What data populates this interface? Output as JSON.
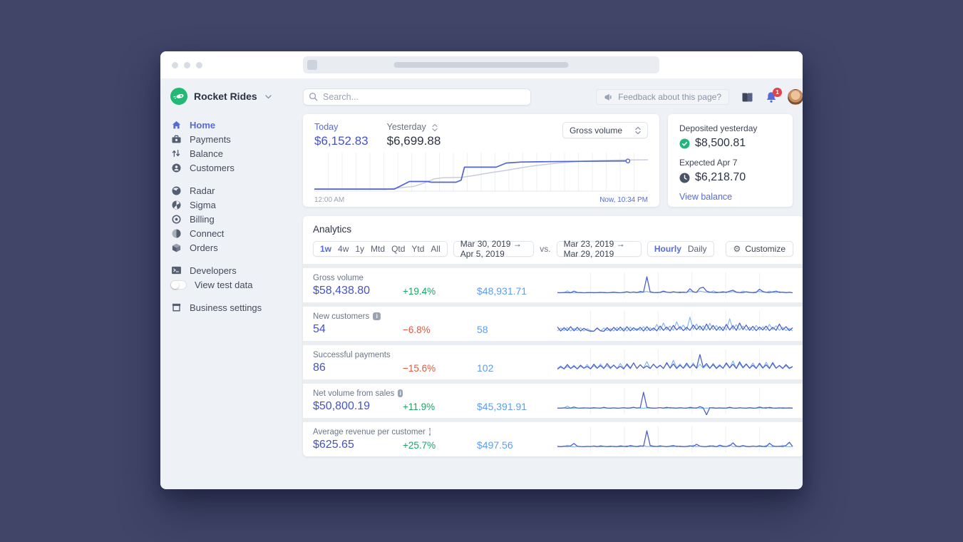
{
  "colors": {
    "accent": "#556cd6",
    "value_indigo": "#4453c8",
    "positive": "#1ea366",
    "negative": "#e4593f",
    "previous_blue": "#5e9df0",
    "spark_current": "#4f61c9",
    "spark_previous": "#7bb3f0",
    "today_line": "#5065cf",
    "yesterday_line": "#c8ced9",
    "check_green": "#24b47e",
    "badge_red": "#e2434b",
    "logo_green": "#23b873"
  },
  "brand": {
    "name": "Rocket Rides"
  },
  "sidebar": {
    "groups": [
      {
        "items": [
          {
            "label": "Home",
            "icon": "home-icon",
            "active": true
          },
          {
            "label": "Payments",
            "icon": "payments-icon"
          },
          {
            "label": "Balance",
            "icon": "balance-icon"
          },
          {
            "label": "Customers",
            "icon": "customers-icon"
          }
        ]
      },
      {
        "items": [
          {
            "label": "Radar",
            "icon": "radar-icon"
          },
          {
            "label": "Sigma",
            "icon": "sigma-icon"
          },
          {
            "label": "Billing",
            "icon": "billing-icon"
          },
          {
            "label": "Connect",
            "icon": "connect-icon"
          },
          {
            "label": "Orders",
            "icon": "orders-icon"
          }
        ]
      },
      {
        "items": [
          {
            "label": "Developers",
            "icon": "developers-icon"
          },
          {
            "label": "View test data",
            "icon": "toggle-switch",
            "toggle": true
          }
        ]
      },
      {
        "items": [
          {
            "label": "Business settings",
            "icon": "settings-icon"
          }
        ]
      }
    ]
  },
  "topbar": {
    "search_placeholder": "Search...",
    "feedback_label": "Feedback about this page?",
    "notification_count": "1"
  },
  "overview": {
    "today_label": "Today",
    "today_value": "$6,152.83",
    "yesterday_label": "Yesterday",
    "yesterday_value": "$6,699.88",
    "metric_select": "Gross volume",
    "x_start": "12:00 AM",
    "x_end": "Now, 10:34 PM"
  },
  "balance_card": {
    "deposited_label": "Deposited yesterday",
    "deposited_value": "$8,500.81",
    "expected_label": "Expected Apr 7",
    "expected_value": "$6,218.70",
    "link": "View balance"
  },
  "analytics": {
    "title": "Analytics",
    "periods": [
      "1w",
      "4w",
      "1y",
      "Mtd",
      "Qtd",
      "Ytd",
      "All"
    ],
    "active_period": "1w",
    "range_primary": "Mar 30, 2019 →  Apr 5, 2019",
    "vs_label": "vs.",
    "range_compare": "Mar 23, 2019 → Mar 29, 2019",
    "granularities": [
      "Hourly",
      "Daily"
    ],
    "active_granularity": "Hourly",
    "customize_label": "Customize"
  },
  "chart_data": {
    "type": "line",
    "title": "Gross volume — Today vs Yesterday (cumulative)",
    "x_range": [
      "12:00 AM",
      "Now, 10:34 PM"
    ],
    "grid": true,
    "series": [
      {
        "name": "Today",
        "end_label": "$6,152.83",
        "points": [
          [
            0,
            0.04
          ],
          [
            0.24,
            0.04
          ],
          [
            0.285,
            0.26
          ],
          [
            0.34,
            0.26
          ],
          [
            0.35,
            0.24
          ],
          [
            0.425,
            0.24
          ],
          [
            0.44,
            0.3
          ],
          [
            0.45,
            0.68
          ],
          [
            0.545,
            0.68
          ],
          [
            0.575,
            0.8
          ],
          [
            0.62,
            0.83
          ],
          [
            0.7,
            0.84
          ],
          [
            0.8,
            0.85
          ],
          [
            0.94,
            0.86
          ]
        ],
        "marker_at": [
          0.94,
          0.86
        ]
      },
      {
        "name": "Yesterday",
        "end_label": "$6,699.88",
        "points": [
          [
            0,
            0.03
          ],
          [
            0.215,
            0.03
          ],
          [
            0.25,
            0.07
          ],
          [
            0.3,
            0.12
          ],
          [
            0.33,
            0.22
          ],
          [
            0.36,
            0.34
          ],
          [
            0.385,
            0.37
          ],
          [
            0.44,
            0.38
          ],
          [
            0.47,
            0.42
          ],
          [
            0.53,
            0.52
          ],
          [
            0.57,
            0.58
          ],
          [
            0.62,
            0.66
          ],
          [
            0.66,
            0.72
          ],
          [
            0.72,
            0.79
          ],
          [
            0.78,
            0.84
          ],
          [
            0.84,
            0.87
          ],
          [
            0.9,
            0.885
          ],
          [
            1,
            0.895
          ]
        ]
      }
    ]
  },
  "metrics": [
    {
      "label": "Gross volume",
      "value": "$58,438.80",
      "delta": "+19.4%",
      "trend": "up",
      "previous": "$48,931.71",
      "info": false,
      "spark": {
        "current": [
          3,
          2,
          4,
          3,
          2,
          12,
          4,
          3,
          2,
          3,
          4,
          2,
          3,
          5,
          3,
          2,
          4,
          6,
          3,
          2,
          5,
          8,
          4,
          6,
          3,
          10,
          6,
          100,
          8,
          4,
          3,
          5,
          12,
          6,
          4,
          8,
          5,
          3,
          6,
          4,
          26,
          8,
          5,
          30,
          36,
          12,
          6,
          4,
          3,
          5,
          8,
          4,
          12,
          18,
          6,
          4,
          3,
          8,
          5,
          3,
          4,
          24,
          10,
          5,
          3,
          8,
          12,
          4,
          6,
          3,
          5,
          2
        ],
        "previous": [
          2,
          3,
          2,
          14,
          3,
          2,
          3,
          4,
          2,
          3,
          2,
          4,
          3,
          2,
          5,
          3,
          2,
          3,
          4,
          2,
          3,
          6,
          3,
          8,
          4,
          3,
          6,
          10,
          5,
          3,
          4,
          3,
          8,
          5,
          3,
          6,
          4,
          8,
          3,
          5,
          10,
          6,
          4,
          12,
          8,
          5,
          3,
          14,
          6,
          4,
          3,
          8,
          5,
          10,
          4,
          3,
          12,
          6,
          3,
          4,
          8,
          10,
          6,
          4,
          12,
          5,
          3,
          9,
          4,
          3,
          6,
          2
        ]
      }
    },
    {
      "label": "New customers",
      "value": "54",
      "delta": "−6.8%",
      "trend": "down",
      "previous": "58",
      "info": true,
      "spark": {
        "current": [
          28,
          4,
          24,
          6,
          30,
          5,
          26,
          4,
          20,
          8,
          2,
          3,
          22,
          5,
          2,
          24,
          4,
          26,
          6,
          28,
          4,
          30,
          5,
          24,
          8,
          26,
          4,
          30,
          6,
          22,
          5,
          34,
          8,
          28,
          5,
          38,
          10,
          30,
          6,
          26,
          8,
          40,
          12,
          34,
          8,
          46,
          10,
          38,
          8,
          30,
          6,
          44,
          10,
          36,
          8,
          52,
          12,
          40,
          8,
          32,
          6,
          28,
          10,
          34,
          6,
          26,
          8,
          46,
          10,
          30,
          6,
          24
        ],
        "previous": [
          4,
          22,
          6,
          26,
          4,
          20,
          6,
          24,
          4,
          18,
          6,
          2,
          20,
          4,
          22,
          6,
          18,
          4,
          26,
          6,
          22,
          4,
          28,
          6,
          20,
          8,
          30,
          5,
          24,
          6,
          44,
          8,
          52,
          10,
          34,
          8,
          60,
          12,
          40,
          8,
          88,
          14,
          46,
          10,
          36,
          8,
          50,
          12,
          38,
          8,
          30,
          10,
          78,
          14,
          42,
          10,
          34,
          8,
          28,
          6,
          38,
          10,
          30,
          8,
          44,
          12,
          36,
          8,
          26,
          6,
          20,
          4
        ]
      }
    },
    {
      "label": "Successful payments",
      "value": "86",
      "delta": "−15.6%",
      "trend": "down",
      "previous": "102",
      "info": false,
      "spark": {
        "current": [
          6,
          20,
          8,
          34,
          10,
          24,
          8,
          30,
          12,
          22,
          8,
          36,
          12,
          28,
          10,
          40,
          14,
          30,
          10,
          24,
          8,
          38,
          12,
          44,
          10,
          32,
          12,
          26,
          10,
          36,
          14,
          30,
          10,
          46,
          12,
          38,
          10,
          30,
          12,
          42,
          14,
          34,
          12,
          95,
          18,
          40,
          12,
          34,
          10,
          28,
          12,
          44,
          14,
          36,
          10,
          50,
          16,
          38,
          12,
          30,
          10,
          42,
          14,
          32,
          10,
          46,
          12,
          28,
          10,
          34,
          12,
          22
        ],
        "previous": [
          10,
          26,
          8,
          22,
          10,
          30,
          8,
          24,
          10,
          34,
          8,
          26,
          10,
          38,
          12,
          28,
          8,
          32,
          10,
          40,
          12,
          30,
          8,
          44,
          10,
          34,
          12,
          52,
          10,
          36,
          12,
          28,
          10,
          40,
          12,
          60,
          14,
          38,
          10,
          32,
          12,
          44,
          10,
          36,
          12,
          30,
          10,
          42,
          14,
          34,
          10,
          38,
          12,
          56,
          10,
          40,
          12,
          34,
          10,
          44,
          12,
          36,
          10,
          48,
          14,
          38,
          10,
          30,
          12,
          26,
          8,
          20
        ]
      }
    },
    {
      "label": "Net volume from sales",
      "value": "$50,800.19",
      "delta": "+11.9%",
      "trend": "up",
      "previous": "$45,391.91",
      "info": true,
      "spark": {
        "current": [
          4,
          3,
          5,
          3,
          4,
          10,
          4,
          3,
          5,
          4,
          3,
          6,
          4,
          3,
          8,
          4,
          3,
          5,
          3,
          4,
          6,
          3,
          5,
          8,
          4,
          6,
          100,
          8,
          5,
          3,
          4,
          6,
          3,
          8,
          4,
          5,
          3,
          6,
          4,
          3,
          8,
          5,
          3,
          12,
          5,
          -38,
          6,
          4,
          3,
          5,
          3,
          4,
          8,
          4,
          3,
          5,
          4,
          3,
          6,
          3,
          4,
          10,
          5,
          3,
          8,
          4,
          3,
          5,
          3,
          4,
          5,
          3
        ],
        "previous": [
          3,
          2,
          4,
          16,
          3,
          2,
          4,
          3,
          2,
          5,
          3,
          2,
          4,
          3,
          5,
          2,
          3,
          4,
          2,
          3,
          5,
          3,
          2,
          6,
          3,
          4,
          2,
          5,
          3,
          2,
          4,
          6,
          3,
          2,
          8,
          3,
          2,
          4,
          3,
          5,
          2,
          3,
          6,
          3,
          2,
          4,
          3,
          8,
          2,
          3,
          4,
          2,
          5,
          3,
          2,
          6,
          3,
          2,
          4,
          3,
          2,
          5,
          3,
          8,
          2,
          3,
          4,
          2,
          6,
          3,
          2,
          4
        ]
      }
    },
    {
      "label": "Average revenue per customer",
      "value": "$625.65",
      "delta": "+25.7%",
      "trend": "up",
      "previous": "$497.56",
      "info": true,
      "spark": {
        "current": [
          5,
          3,
          6,
          4,
          8,
          22,
          6,
          4,
          3,
          5,
          4,
          6,
          3,
          8,
          5,
          3,
          6,
          4,
          3,
          8,
          5,
          3,
          10,
          6,
          4,
          8,
          5,
          100,
          10,
          6,
          4,
          8,
          5,
          3,
          6,
          10,
          4,
          6,
          3,
          5,
          8,
          4,
          18,
          6,
          4,
          3,
          8,
          5,
          3,
          12,
          6,
          4,
          8,
          26,
          6,
          4,
          10,
          5,
          3,
          6,
          4,
          8,
          5,
          3,
          24,
          8,
          4,
          6,
          3,
          10,
          30,
          4
        ],
        "previous": [
          3,
          2,
          4,
          12,
          3,
          2,
          5,
          3,
          2,
          4,
          3,
          8,
          4,
          2,
          5,
          3,
          2,
          6,
          3,
          2,
          4,
          8,
          3,
          5,
          2,
          4,
          10,
          3,
          5,
          2,
          4,
          3,
          6,
          2,
          5,
          3,
          8,
          2,
          4,
          3,
          5,
          12,
          3,
          6,
          2,
          4,
          3,
          10,
          2,
          5,
          3,
          4,
          14,
          3,
          5,
          2,
          6,
          3,
          2,
          8,
          3,
          5,
          2,
          10,
          4,
          2,
          6,
          3,
          12,
          4,
          2,
          5
        ]
      }
    }
  ]
}
